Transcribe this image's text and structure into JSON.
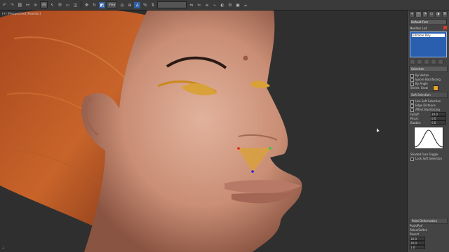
{
  "toolbar": {
    "selection_filter": "All",
    "view": "View",
    "named_selection": "",
    "icons": [
      "undo-icon",
      "redo-icon",
      "link-icon",
      "unlink-icon",
      "bind-icon",
      "select-icon",
      "select-name-icon",
      "rect-select-icon",
      "window-crossing-icon",
      "move-icon",
      "rotate-icon",
      "scale-icon",
      "pivot-icon",
      "snap-icon",
      "angle-snap-icon",
      "percent-snap-icon",
      "spinner-snap-icon",
      "mirror-icon",
      "align-icon",
      "layer-icon",
      "graph-icon",
      "material-icon",
      "render-setup-icon",
      "render-frame-icon",
      "render-icon"
    ]
  },
  "viewport": {
    "label": "[+] [Perspective] [Realistic]"
  },
  "command_panel": {
    "tabs": [
      "+",
      "~",
      "◔",
      "▭",
      "◑",
      "⚒"
    ],
    "object_name": "Default Fem",
    "modifier_list_label": "Modifier List",
    "stack_item": "Editable Poly",
    "rollouts": {
      "selection": "Selection",
      "soft_selection": "Soft Selection",
      "paint_deform": "Paint Deformation"
    },
    "options": [
      "By Vertex",
      "Ignore Backfacing",
      "By Angle",
      "Shrink",
      "Grow"
    ],
    "soft_options": [
      "Use Soft Selection",
      "Edge Distance",
      "Affect Backfacing"
    ],
    "spinners": [
      "Falloff:",
      "Pinch:",
      "Bubble:"
    ],
    "falloff_value": "20.0",
    "pinch_value": "0.0",
    "bubble_value": "0.0",
    "shaded_face_toggle": "Shaded Face Toggle",
    "lock_soft_selection": "Lock Soft Selection",
    "paint_buttons": [
      "Push/Pull",
      "Relax/Soften",
      "Revert"
    ],
    "push_value": "10.0",
    "brush_size": "20.0",
    "brush_strength": "1.0",
    "accent_color": "#e8a42a",
    "swatch_color": "#d63c24"
  }
}
